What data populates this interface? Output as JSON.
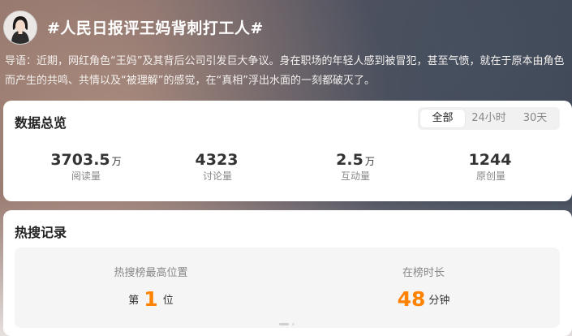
{
  "topic": {
    "title": "#人民日报评王妈背刺打工人#",
    "intro": "导语：近期，网红角色“王妈”及其背后公司引发巨大争议。身在职场的年轻人感到被冒犯，甚至气愤，就在于原本由角色而产生的共鸣、共情以及“被理解”的感觉，在“真相”浮出水面的一刻都破灭了。"
  },
  "overview": {
    "title": "数据总览",
    "tabs": [
      "全部",
      "24小时",
      "30天"
    ],
    "active_tab": "全部",
    "stats": [
      {
        "value": "3703.5",
        "unit": "万",
        "label": "阅读量"
      },
      {
        "value": "4323",
        "unit": "",
        "label": "讨论量"
      },
      {
        "value": "2.5",
        "unit": "万",
        "label": "互动量"
      },
      {
        "value": "1244",
        "unit": "",
        "label": "原创量"
      }
    ]
  },
  "hot": {
    "title": "热搜记录",
    "peak": {
      "label": "热搜榜最高位置",
      "prefix": "第",
      "value": "1",
      "suffix": "位"
    },
    "duration": {
      "label": "在榜时长",
      "value": "48",
      "unit": "分钟"
    }
  },
  "colors": {
    "accent": "#ff8200",
    "card_bg": "#ffffff",
    "tab_bg": "#f1f1f1"
  }
}
